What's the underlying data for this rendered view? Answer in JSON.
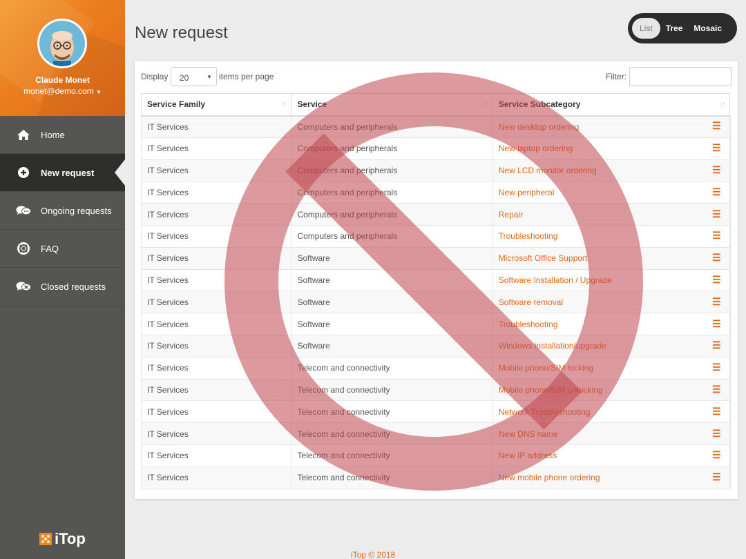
{
  "user": {
    "name": "Claude Monet",
    "email": "monet@demo.com"
  },
  "nav": [
    {
      "label": "Home",
      "icon": "home-icon",
      "active": false
    },
    {
      "label": "New request",
      "icon": "plus-circle-icon",
      "active": true
    },
    {
      "label": "Ongoing requests",
      "icon": "chat-bubbles-icon",
      "active": false
    },
    {
      "label": "FAQ",
      "icon": "lifebuoy-icon",
      "active": false
    },
    {
      "label": "Closed requests",
      "icon": "chat-bubbles-closed-icon",
      "active": false
    }
  ],
  "logo": {
    "text": "iTop"
  },
  "page_title": "New request",
  "view_switch": {
    "list": "List",
    "tree": "Tree",
    "mosaic": "Mosaic",
    "selected": "List"
  },
  "toolbar": {
    "display_label": "Display",
    "page_size": "20",
    "per_page_label": "items per page",
    "filter_label": "Filter:",
    "filter_value": ""
  },
  "table": {
    "headers": [
      "Service Family",
      "Service",
      "Service Subcategory"
    ],
    "rows": [
      [
        "IT Services",
        "Computers and peripherals",
        "New desktop ordering"
      ],
      [
        "IT Services",
        "Computers and peripherals",
        "New laptop ordering"
      ],
      [
        "IT Services",
        "Computers and peripherals",
        "New LCD monitor ordering"
      ],
      [
        "IT Services",
        "Computers and peripherals",
        "New peripheral"
      ],
      [
        "IT Services",
        "Computers and peripherals",
        "Repair"
      ],
      [
        "IT Services",
        "Computers and peripherals",
        "Troubleshooting"
      ],
      [
        "IT Services",
        "Software",
        "Microsoft Office Support"
      ],
      [
        "IT Services",
        "Software",
        "Software Installation / Upgrade"
      ],
      [
        "IT Services",
        "Software",
        "Software removal"
      ],
      [
        "IT Services",
        "Software",
        "Troubleshooting"
      ],
      [
        "IT Services",
        "Software",
        "Windows installation/upgrade"
      ],
      [
        "IT Services",
        "Telecom and connectivity",
        "Mobile phone/SIM locking"
      ],
      [
        "IT Services",
        "Telecom and connectivity",
        "Mobile phone/SIM unlocking"
      ],
      [
        "IT Services",
        "Telecom and connectivity",
        "Network Troubleshooting"
      ],
      [
        "IT Services",
        "Telecom and connectivity",
        "New DNS name"
      ],
      [
        "IT Services",
        "Telecom and connectivity",
        "New IP address"
      ],
      [
        "IT Services",
        "Telecom and connectivity",
        "New mobile phone ordering"
      ]
    ]
  },
  "footer": "iTop © 2018",
  "colors": {
    "accent": "#e0681a",
    "sidebar": "#555553",
    "watermark": "#c0464e"
  }
}
